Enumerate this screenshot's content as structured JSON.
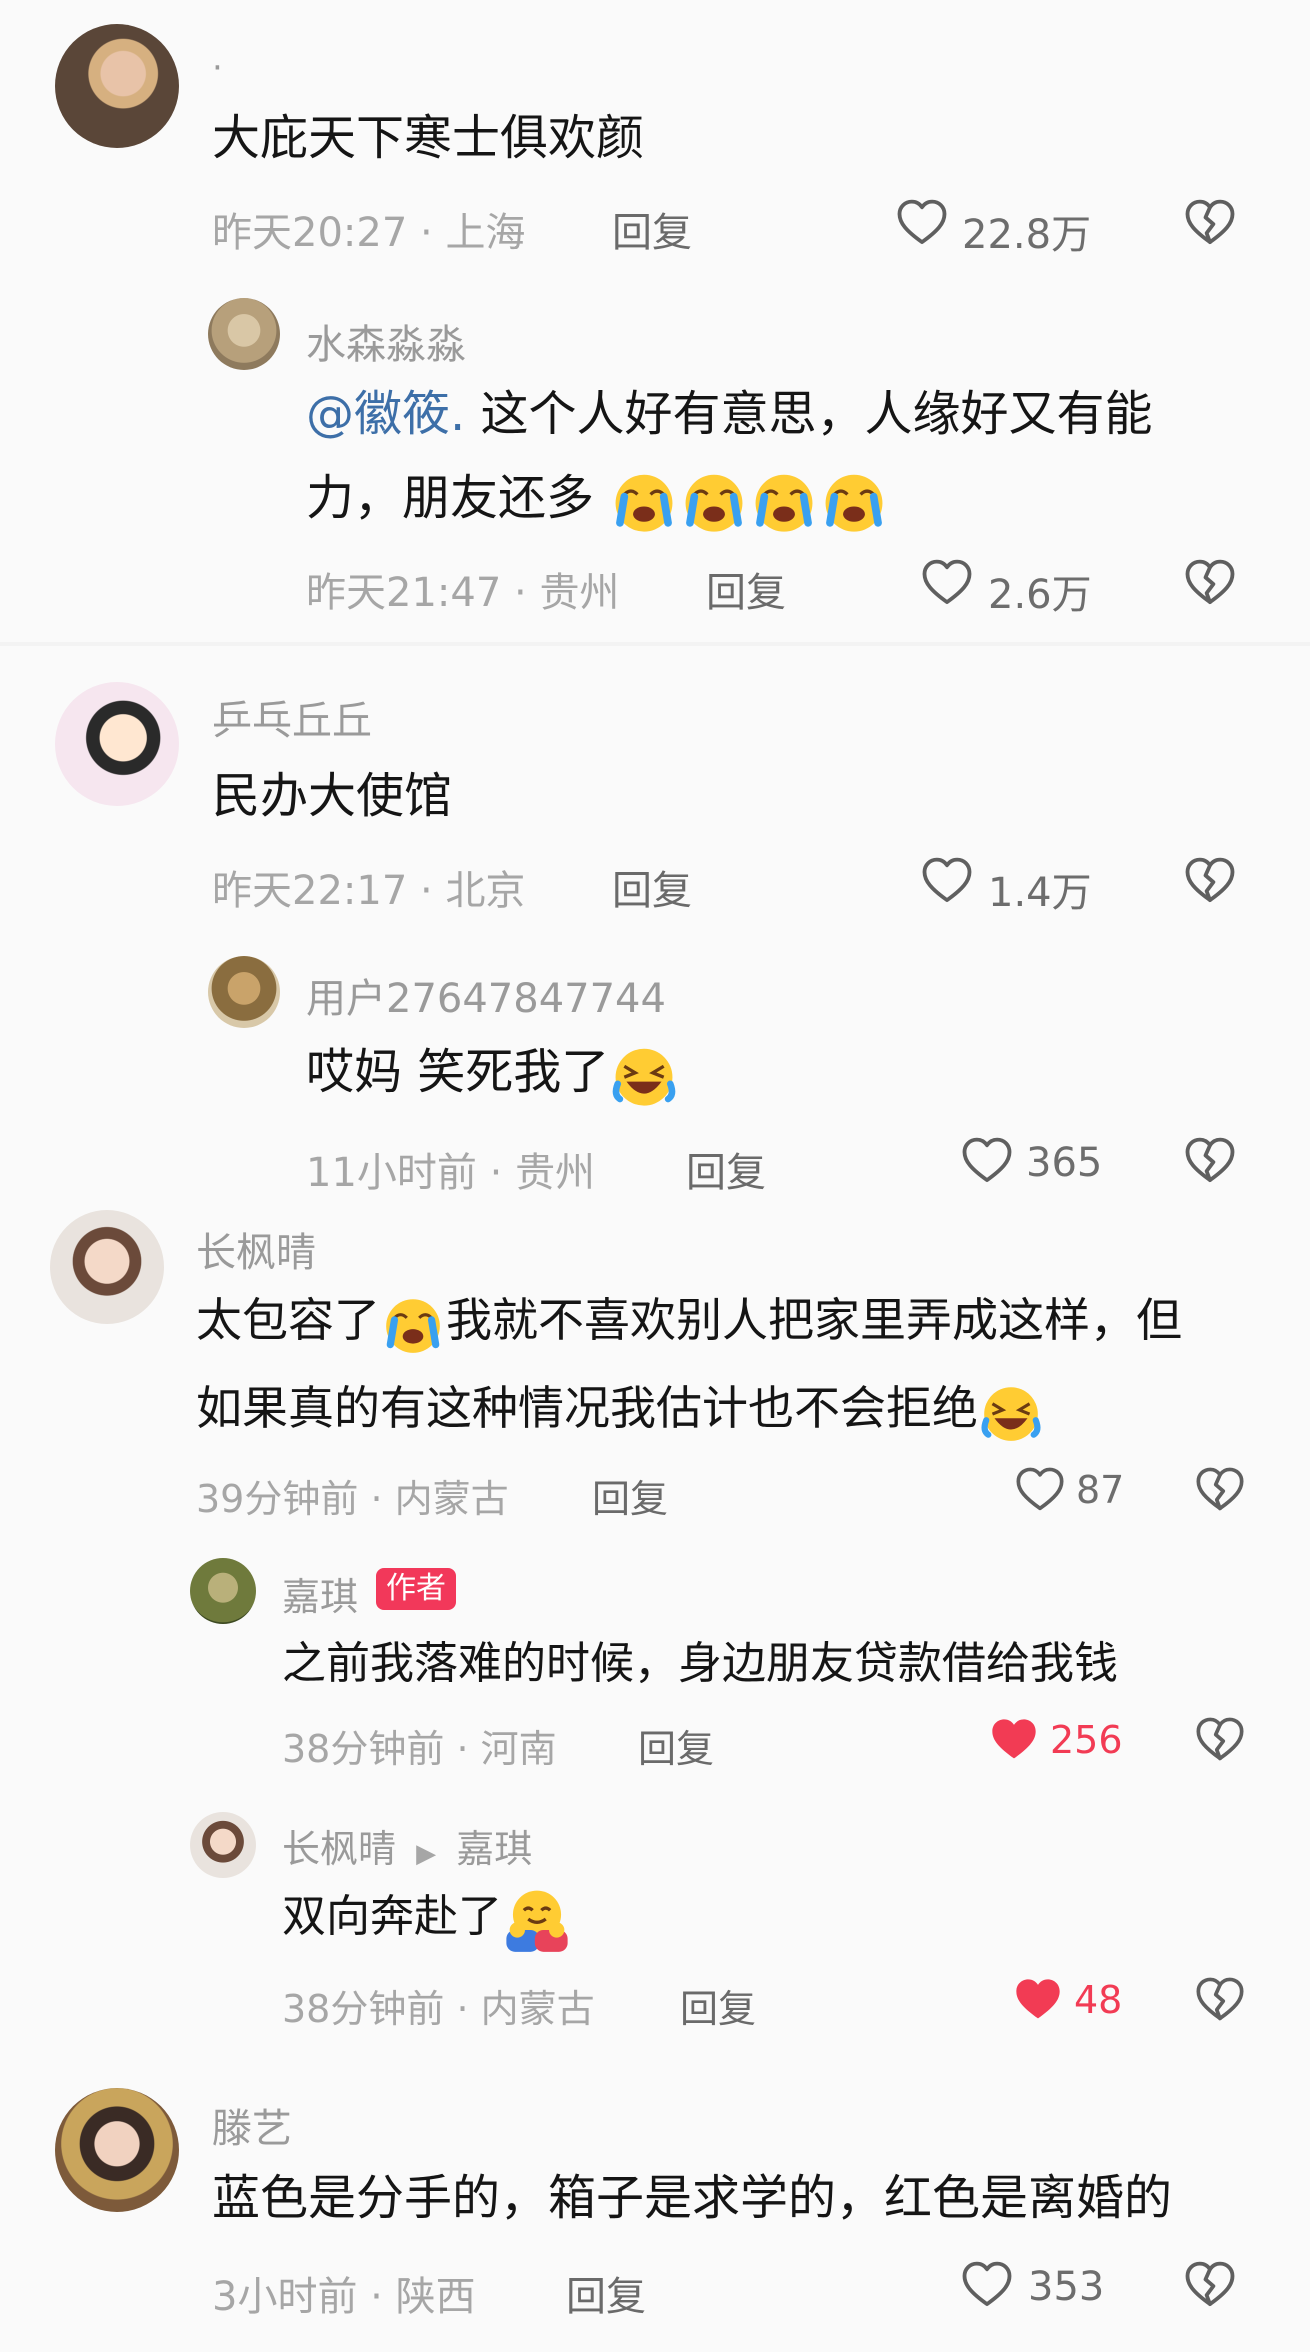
{
  "comments": [
    {
      "user": "·",
      "text": "大庇天下寒士俱欢颜",
      "time": "昨天20:27",
      "location": "上海",
      "reply_label": "回复",
      "likes": "22.8万",
      "liked": false
    },
    {
      "user": "水森淼淼",
      "mention": "@徽筱.",
      "text_after_mention": " 这个人好有意思，人缘好又有能",
      "text_line2": "力，朋友还多",
      "time": "昨天21:47",
      "location": "贵州",
      "reply_label": "回复",
      "likes": "2.6万",
      "liked": false
    },
    {
      "user": "乒乓丘丘",
      "text": "民办大使馆",
      "time": "昨天22:17",
      "location": "北京",
      "reply_label": "回复",
      "likes": "1.4万",
      "liked": false
    },
    {
      "user": "用户27647847744",
      "text": "哎妈 笑死我了",
      "time": "11小时前",
      "location": "贵州",
      "reply_label": "回复",
      "likes": "365",
      "liked": false
    },
    {
      "user": "长枫晴",
      "text_line1_a": "太包容了",
      "text_line1_b": "我就不喜欢别人把家里弄成这样，但",
      "text_line2": "如果真的有这种情况我估计也不会拒绝",
      "time": "39分钟前",
      "location": "内蒙古",
      "reply_label": "回复",
      "likes": "87",
      "liked": false
    },
    {
      "user": "嘉琪",
      "badge": "作者",
      "text": "之前我落难的时候，身边朋友贷款借给我钱",
      "time": "38分钟前",
      "location": "河南",
      "reply_label": "回复",
      "likes": "256",
      "liked": true
    },
    {
      "user": "长枫晴",
      "reply_to": "嘉琪",
      "text": "双向奔赴了",
      "time": "38分钟前",
      "location": "内蒙古",
      "reply_label": "回复",
      "likes": "48",
      "liked": true
    },
    {
      "user": "滕艺",
      "text": "蓝色是分手的，箱子是求学的，红色是离婚的",
      "time": "3小时前",
      "location": "陕西",
      "reply_label": "回复",
      "likes": "353",
      "liked": false
    }
  ],
  "separator": " · ",
  "colors": {
    "liked": "#f23b54",
    "mention": "#3d6fa8",
    "meta": "#a6a6a6",
    "name": "#9a9a9a"
  },
  "icons": {
    "like": "heart-outline-icon",
    "liked": "heart-filled-icon",
    "dislike": "broken-heart-icon"
  }
}
